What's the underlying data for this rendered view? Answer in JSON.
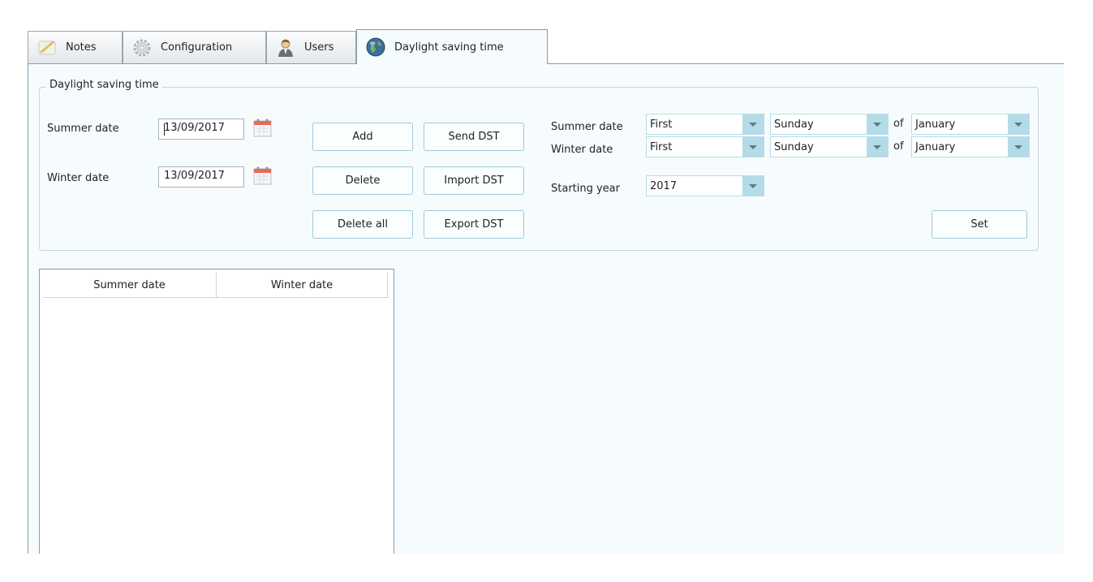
{
  "tabs": [
    {
      "label": "Notes",
      "icon": "notes-icon",
      "active": false
    },
    {
      "label": "Configuration",
      "icon": "gear-icon",
      "active": false
    },
    {
      "label": "Users",
      "icon": "user-icon",
      "active": false
    },
    {
      "label": "Daylight saving time",
      "icon": "globe-icon",
      "active": true
    }
  ],
  "group": {
    "title": "Daylight saving time",
    "summer_label": "Summer date",
    "summer_value": "13/09/2017",
    "winter_label": "Winter date",
    "winter_value": "13/09/2017"
  },
  "buttons": {
    "add": "Add",
    "delete": "Delete",
    "delete_all": "Delete all",
    "send": "Send DST",
    "import": "Import DST",
    "export": "Export DST",
    "set": "Set"
  },
  "rule": {
    "summer_label": "Summer date",
    "winter_label": "Winter date",
    "year_label": "Starting year",
    "of_label": "of",
    "summer_ordinal": "First",
    "summer_day": "Sunday",
    "summer_month": "January",
    "winter_ordinal": "First",
    "winter_day": "Sunday",
    "winter_month": "January",
    "year": "2017"
  },
  "table": {
    "columns": [
      "Summer date",
      "Winter date"
    ],
    "rows": []
  },
  "colors": {
    "panel_bg": "#f6fcfe",
    "combo_button": "#b3dbe8",
    "button_border": "#9ec9d9"
  }
}
